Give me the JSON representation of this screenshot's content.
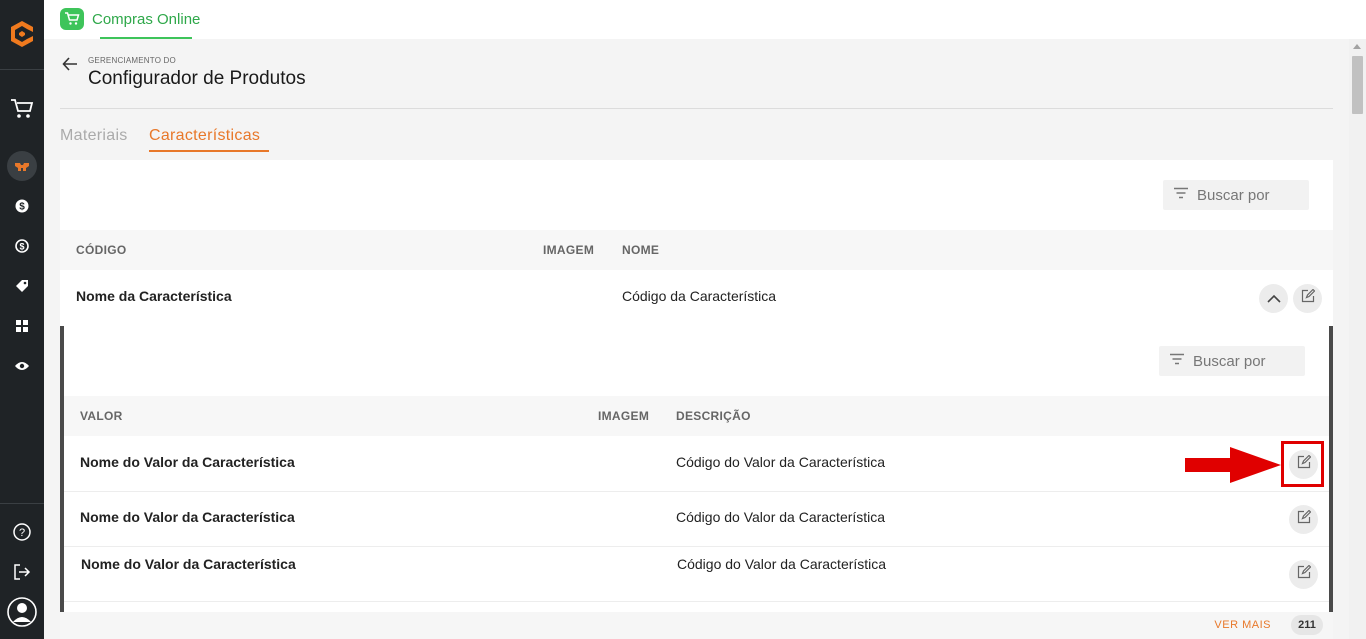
{
  "app": {
    "title": "Compras Online"
  },
  "header": {
    "breadcrumb": "GERENCIAMENTO DO",
    "title": "Configurador de Produtos"
  },
  "tabs": [
    {
      "label": "Materiais",
      "active": false
    },
    {
      "label": "Características",
      "active": true
    }
  ],
  "outer_table": {
    "search_placeholder": "Buscar por",
    "columns": [
      "CÓDIGO",
      "IMAGEM",
      "NOME"
    ],
    "row": {
      "code": "Nome da Característica",
      "name": "Código da Característica"
    }
  },
  "inner_table": {
    "search_placeholder": "Buscar por",
    "columns": [
      "VALOR",
      "IMAGEM",
      "DESCRIÇÃO"
    ],
    "rows": [
      {
        "value": "Nome do Valor da Característica",
        "description": "Código do Valor da Característica"
      },
      {
        "value": "Nome do Valor da Característica",
        "description": "Código do Valor da Característica"
      },
      {
        "value": "Nome do Valor da Característica",
        "description": "Código do Valor da Característica"
      }
    ]
  },
  "footer": {
    "ver_mais": "VER MAIS",
    "count": "211"
  },
  "colors": {
    "accent": "#e8782a",
    "brand_green": "#3ec45a",
    "sidebar": "#1f2326",
    "annotation_red": "#e00000"
  },
  "icons": {
    "sidebar": [
      "logo-icon",
      "cart-icon",
      "configurator-icon",
      "dollar-icon",
      "exchange-icon",
      "tag-icon",
      "grid-icon",
      "eye-icon",
      "help-icon",
      "logout-icon",
      "user-avatar-icon"
    ],
    "actions": [
      "chevron-up-icon",
      "edit-icon",
      "filter-icon",
      "back-arrow-icon"
    ]
  }
}
